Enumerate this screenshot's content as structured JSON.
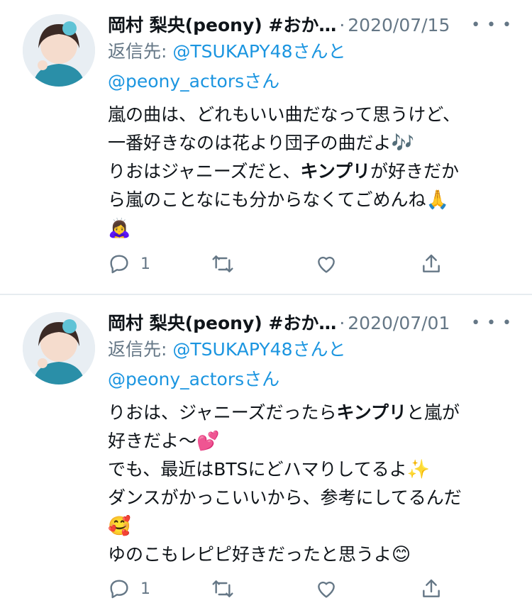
{
  "tweets": [
    {
      "name": "岡村 梨央(peony) #おか…",
      "date": "2020/07/15",
      "reply_prefix": "返信先: ",
      "reply_handle1": "@TSUKAPY48さんと",
      "reply_handle2": "@peony_actorsさん",
      "lines": [
        {
          "a": "嵐の曲は、どれもいい曲だなって思うけど、"
        },
        {
          "a": "一番好きなのは花より団子の曲だよ",
          "emoji": "🎶"
        },
        {
          "a": "りおはジャニーズだと、",
          "bold": "キンプリ",
          "b": "が好きだか"
        },
        {
          "a": "ら嵐のことなにも分からなくてごめんね",
          "emoji": "🙏"
        },
        {
          "a": "",
          "emoji": "🙇‍♀️"
        }
      ],
      "reply_count": "1"
    },
    {
      "name": "岡村 梨央(peony) #おか…",
      "date": "2020/07/01",
      "reply_prefix": "返信先: ",
      "reply_handle1": "@TSUKAPY48さんと",
      "reply_handle2": "@peony_actorsさん",
      "lines": [
        {
          "a": "りおは、ジャニーズだったら",
          "bold": "キンプリ",
          "b": "と嵐が"
        },
        {
          "a": "好きだよ〜",
          "emoji": "💕"
        },
        {
          "a": "でも、最近はBTSにどハマりしてるよ",
          "emoji": "✨"
        },
        {
          "a": "ダンスがかっこいいから、参考にしてるんだ"
        },
        {
          "a": "",
          "emoji": "🥰"
        },
        {
          "a": "ゆのこもレピピ好きだったと思うよ",
          "emoji": "😊"
        }
      ],
      "reply_count": "1"
    }
  ],
  "icons": {
    "more": "more-icon",
    "reply": "reply-icon",
    "retweet": "retweet-icon",
    "like": "like-icon",
    "share": "share-icon"
  },
  "colors": {
    "accent": "#1b95e0",
    "muted": "#657786",
    "text": "#0f1419"
  }
}
